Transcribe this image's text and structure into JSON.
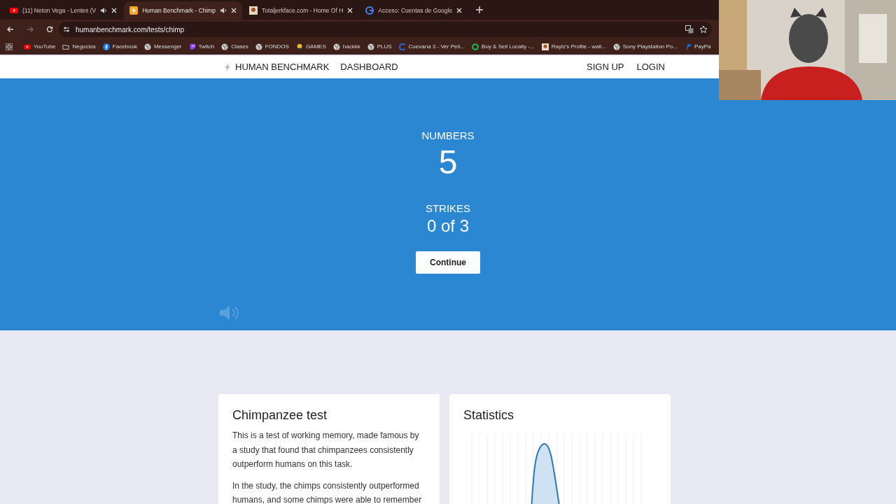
{
  "tabs": [
    {
      "title": "(11) Neton Vega - Lentes (V",
      "audio": true,
      "selected": false
    },
    {
      "title": "Human Benchmark - Chimp",
      "audio": true,
      "selected": true
    },
    {
      "title": "Totaljerkface.com - Home Of H",
      "audio": false,
      "selected": false
    },
    {
      "title": "Acceso: Cuentas de Google",
      "audio": false,
      "selected": false
    }
  ],
  "address": "humanbenchmark.com/tests/chimp",
  "bookmarks": [
    "YouTube",
    "Negocios",
    "Facebook",
    "Messenger",
    "Twitch",
    "Clases",
    "FONDOS",
    "GAMES",
    "hackkk",
    "PLUS",
    "Cuevana 3 - Ver Pelí...",
    "Buy & Sell Locally -...",
    "Raylz's Profile - wall...",
    "Sony Playstation Po...",
    "PayPa"
  ],
  "site_nav": {
    "brand": "HUMAN BENCHMARK",
    "links": [
      "DASHBOARD"
    ],
    "right_links": [
      "SIGN UP",
      "LOGIN"
    ]
  },
  "hero": {
    "numbers_label": "NUMBERS",
    "numbers_value": "5",
    "strikes_label": "STRIKES",
    "strikes_value": "0 of 3",
    "button": "Continue"
  },
  "cards": [
    {
      "title": "Chimpanzee test",
      "paragraphs": [
        "This is a test of working memory, made famous by a study that found that chimpanzees consistently outperform humans on this task.",
        "In the study, the chimps consistently outperformed humans, and some chimps were able to remember"
      ]
    },
    {
      "title": "Statistics"
    }
  ]
}
